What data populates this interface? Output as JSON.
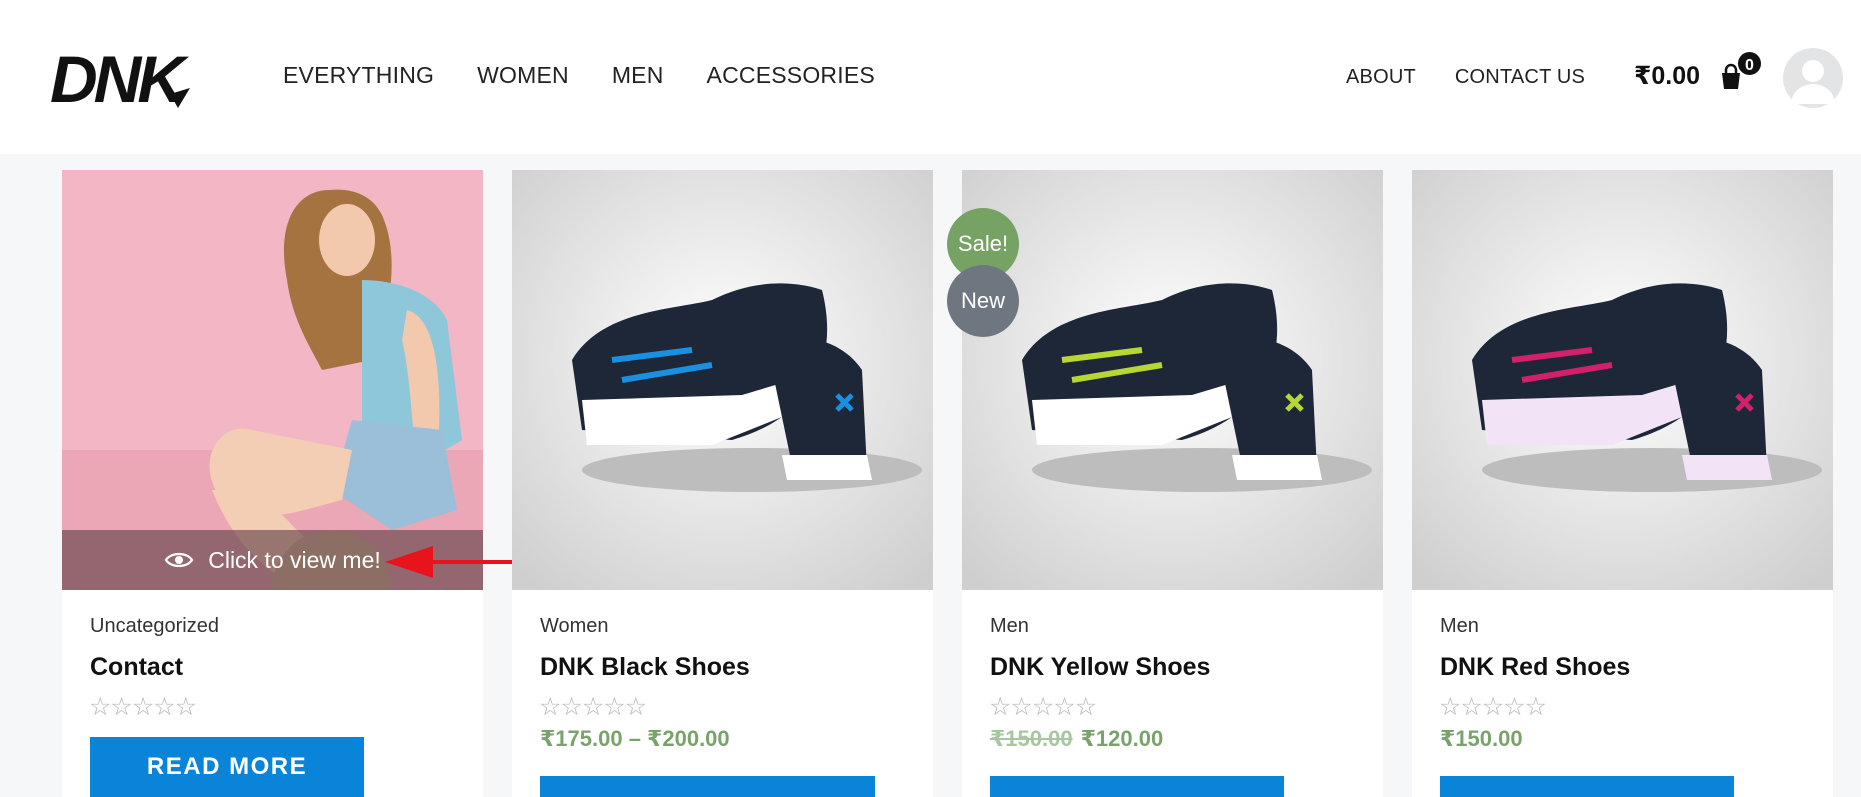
{
  "header": {
    "logo_text": "DNK",
    "nav_left": [
      "EVERYTHING",
      "WOMEN",
      "MEN",
      "ACCESSORIES"
    ],
    "nav_right": [
      "ABOUT",
      "CONTACT US"
    ],
    "cart_total": "₹0.00",
    "cart_count": "0"
  },
  "overlay": {
    "label": "Click to view me!"
  },
  "products": [
    {
      "category": "Uncategorized",
      "title": "Contact",
      "stars": "☆☆☆☆☆",
      "button": "READ MORE",
      "colors": {
        "accent": "#ffffff"
      }
    },
    {
      "category": "Women",
      "title": "DNK Black Shoes",
      "stars": "☆☆☆☆☆",
      "price": "₹175.00 – ₹200.00",
      "colors": {
        "accent": "#1b8fe0"
      }
    },
    {
      "category": "Men",
      "title": "DNK Yellow Shoes",
      "stars": "☆☆☆☆☆",
      "price_old": "₹150.00",
      "price_new": "₹120.00",
      "badges": [
        "Sale!",
        "New"
      ],
      "colors": {
        "accent": "#b8d634"
      }
    },
    {
      "category": "Men",
      "title": "DNK Red Shoes",
      "stars": "☆☆☆☆☆",
      "price": "₹150.00",
      "colors": {
        "accent": "#d4206a"
      }
    }
  ],
  "colors": {
    "button": "#0a84d8",
    "price": "#7aa36c",
    "sale_badge": "#76a363",
    "new_badge": "#6e7680"
  }
}
